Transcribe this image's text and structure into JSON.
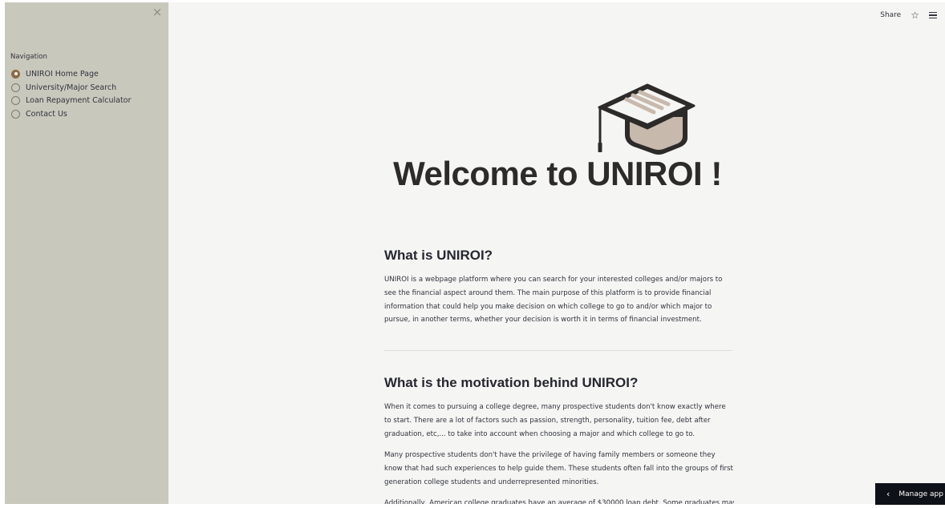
{
  "sidebar": {
    "close_label": "×",
    "nav_title": "Navigation",
    "items": [
      {
        "label": "UNIROI Home Page",
        "selected": true
      },
      {
        "label": "University/Major Search",
        "selected": false
      },
      {
        "label": "Loan Repayment Calculator",
        "selected": false
      },
      {
        "label": "Contact Us",
        "selected": false
      }
    ]
  },
  "toolbar": {
    "share_label": "Share",
    "star_icon": "star-icon",
    "menu_icon": "hamburger-menu-icon"
  },
  "hero": {
    "title": "Welcome to UNIROI !",
    "logo_icon": "graduation-cap-icon"
  },
  "sections": [
    {
      "heading": "What is UNIROI?",
      "paragraphs": [
        "UNIROI is a webpage platform where you can search for your interested colleges and/or majors to see the financial aspect around them. The main purpose of this platform is to provide financial information that could help you make decision on which college to go to and/or which major to pursue, in another terms, whether your decision is worth it in terms of financial investment."
      ]
    },
    {
      "heading": "What is the motivation behind UNIROI?",
      "paragraphs": [
        "When it comes to pursuing a college degree, many prospective students don't know exactly where to start. There are a lot of factors such as passion, strength, personality, tuition fee, debt after graduation, etc,... to take into account when choosing a major and which college to go to.",
        "Many prospective students don't have the privilege of having family members or someone they know that had such experiences to help guide them. These students often fall into the groups of first generation college students and underrepresented minorities.",
        "Additionally, American college graduates have an average of $30000 loan debt. Some graduates may end"
      ]
    }
  ],
  "manage_app": {
    "label": "Manage app"
  },
  "colors": {
    "sidebar_bg": "#c9c8bc",
    "main_bg": "#f5f5f3",
    "radio_selected": "#8e6a48",
    "manage_app_bg": "#0e1117"
  }
}
